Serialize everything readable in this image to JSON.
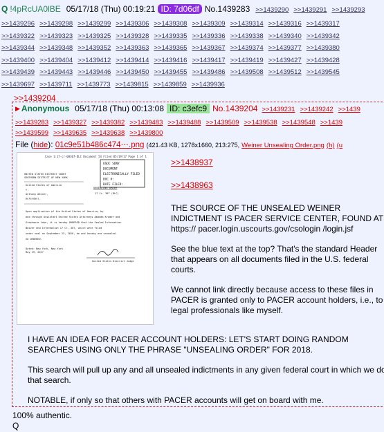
{
  "top_post": {
    "trip_name": "Q",
    "trip_code": "!4pRcUA0lBE",
    "date": "05/17/18 (Thu) 00:19:21",
    "id_label": "ID: 7d06df",
    "no_label": "No.1439283",
    "replies": [
      [
        "&gt;&gt;1439290",
        "&gt;&gt;1439291",
        "&gt;&gt;1439293"
      ],
      [
        "&gt;&gt;1439296",
        "&gt;&gt;1439298",
        "&gt;&gt;1439299",
        "&gt;&gt;1439306",
        "&gt;&gt;1439308",
        "&gt;&gt;1439309",
        "&gt;&gt;1439314",
        "&gt;&gt;1439316",
        "&gt;&gt;1439317"
      ],
      [
        "&gt;&gt;1439322",
        "&gt;&gt;1439323",
        "&gt;&gt;1439325",
        "&gt;&gt;1439328",
        "&gt;&gt;1439335",
        "&gt;&gt;1439336",
        "&gt;&gt;1439338",
        "&gt;&gt;1439340",
        "&gt;&gt;1439342"
      ],
      [
        "&gt;&gt;1439344",
        "&gt;&gt;1439348",
        "&gt;&gt;1439352",
        "&gt;&gt;1439363",
        "&gt;&gt;1439365",
        "&gt;&gt;1439367",
        "&gt;&gt;1439374",
        "&gt;&gt;1439377",
        "&gt;&gt;1439380"
      ],
      [
        "&gt;&gt;1439400",
        "&gt;&gt;1439404",
        "&gt;&gt;1439412",
        "&gt;&gt;1439414",
        "&gt;&gt;1439416",
        "&gt;&gt;1439417",
        "&gt;&gt;1439419",
        "&gt;&gt;1439427",
        "&gt;&gt;1439428"
      ],
      [
        "&gt;&gt;1439439",
        "&gt;&gt;1439443",
        "&gt;&gt;1439446",
        "&gt;&gt;1439450",
        "&gt;&gt;1439455",
        "&gt;&gt;1439486",
        "&gt;&gt;1439508",
        "&gt;&gt;1439512",
        "&gt;&gt;1439545"
      ],
      [
        "&gt;&gt;1439697",
        "&gt;&gt;1439711",
        "&gt;&gt;1439773",
        "&gt;&gt;1439815",
        "&gt;&gt;1439859",
        "&gt;&gt;1439936"
      ]
    ]
  },
  "quoted_ref": ">>1439204",
  "reply_post": {
    "name": "Anonymous",
    "date": "05/17/18 (Thu) 00:13:08",
    "id_label": "ID: c3efc9",
    "no_label": "No.1439204",
    "header_replies": [
      ">>1439231",
      ">>1439242",
      ">>1439"
    ],
    "reply_rows": [
      [
        ">>1439283",
        ">>1439327",
        ">>1439382",
        ">>1439483",
        ">>1439488",
        ">>1439509",
        ">>1439538",
        ">>1439548",
        ">>1439"
      ],
      [
        ">>1439599",
        ">>1439635",
        ">>1439638",
        ">>1439800"
      ]
    ],
    "file_label": "File",
    "hide_label": "hide",
    "file_name": "01c9e51b486c474⋯.png",
    "file_meta": "(421.43 KB, 1278x1660, 213:275,",
    "orig_name": "Weiner Unsealing Order.png",
    "h_label": "(h)",
    "u_label": "(u",
    "quote1": ">>1438937",
    "quote2": ">>1438963",
    "para1": "THE SOURCE OF THE UNSEALED WEINER INDICTMENT IS PACER SERVICE CENTER, FOUND AT https:// pacer.login.uscourts.gov/csologin /login.jsf",
    "para2": "See the blue text at the top?  That's the standard Header that appears on all documents filed in the U.S. federal courts.",
    "para3": "We cannot link directly because access to these files in PACER is granted only to PACER account holders, i.e., to legal professionals like myself.",
    "para4": "I HAVE AN IDEA FOR PACER ACCOUNT HOLDERS:  LET'S START DOING RANDOM SEARCHES USING ONLY THE PHRASE \"UNSEALING ORDER\" FOR 2018.",
    "para5": "This search will pull up any and all unsealed indictments in any given federal court in which  we do that search.",
    "para6": "NOTABLE, if only so that others with PACER accounts will get on board with me."
  },
  "after_text": {
    "line1": "100% authentic.",
    "line2": "Q"
  },
  "doc_image": {
    "stamp_lines": [
      "USDC SDNY",
      "DOCUMENT",
      "ELECTRONICALLY FILED",
      "DOC #:",
      "DATE FILED:"
    ],
    "header_lines": [
      "UNITED STATES DISTRICT COURT",
      "SOUTHERN DISTRICT OF NEW YORK"
    ],
    "caption_lines": [
      "United States of America",
      "v.",
      "Anthony Weiner,",
      "Defendant."
    ],
    "title": "UNSEALING ORDER",
    "case_no": "17 Cr. 307 (DLC)",
    "body_lines": [
      "Upon application of the United States of America, by",
      "and through Assistant United States Attorneys Amanda Kramer and",
      "Stephanie Lake, it is hereby ORDERED that the Sealed Information",
      "Waiver and Information 17 Cr. 307, which were filed",
      "under seal on September 25, 2016, be and hereby are unsealed.",
      "SO ORDERED."
    ],
    "place_date": [
      "Dated: New York, New York",
      "May 19, 2017"
    ],
    "signer": "United States District Judge"
  },
  "colors": {
    "background": "#eef2ff",
    "red_link": "#dd0000",
    "trip_green": "#117743",
    "id_purple": "#8a2be2",
    "id_green": "#9be39b"
  }
}
